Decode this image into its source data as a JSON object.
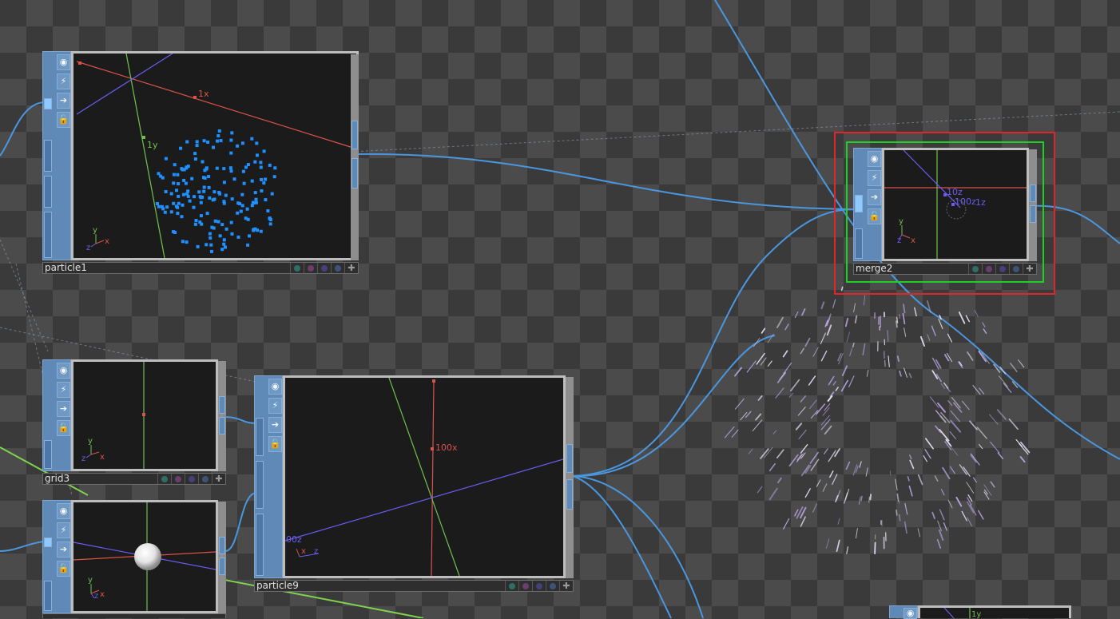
{
  "nodes": [
    {
      "id": "particle1",
      "name": "particle1",
      "axis_labels": [
        "1x",
        "1y"
      ],
      "gizmo": [
        "y",
        "z",
        "x"
      ]
    },
    {
      "id": "grid3",
      "name": "grid3",
      "gizmo": [
        "y",
        "z",
        "x"
      ]
    },
    {
      "id": "sphere",
      "name": "",
      "gizmo": [
        "y",
        "z",
        "x"
      ]
    },
    {
      "id": "particle9",
      "name": "particle9",
      "axis_labels": [
        "100x",
        "00z"
      ],
      "gizmo": [
        "x",
        "z"
      ]
    },
    {
      "id": "merge2",
      "name": "merge2",
      "axis_labels": [
        "10z",
        "100z",
        "1z"
      ],
      "gizmo": [
        "y",
        "z",
        "x"
      ]
    },
    {
      "id": "partial",
      "axis_labels": [
        "1y"
      ]
    }
  ],
  "toolbar_icons": [
    "viewer-icon",
    "bypass-icon",
    "cook-icon",
    "lock-icon"
  ],
  "colors": {
    "node_blue": "#5f8ab7",
    "wire_blue": "#4a97e0",
    "selection_red": "#e0262b",
    "selection_green": "#1fcf23",
    "axis_red": "#d9534a",
    "axis_green": "#6fc04f",
    "axis_blue": "#6a5cf0",
    "particle_blue": "#1e90ff"
  }
}
